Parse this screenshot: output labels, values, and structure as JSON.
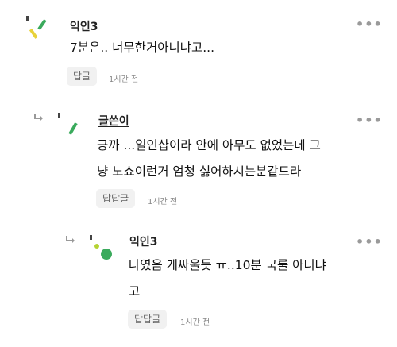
{
  "comments": [
    {
      "author": "익인3",
      "lines": [
        "7분은.. 너무한거아니냐고..."
      ],
      "reply_label": "답글",
      "time": "1시간 전"
    },
    {
      "author": "글쓴이",
      "lines": [
        "긍까 ...일인샵이라 안에 아무도 없었는데 그",
        "냥 노쇼이런거 엄청 싫어하시는분같드라"
      ],
      "reply_label": "답답글",
      "time": "1시간 전"
    },
    {
      "author": "익인3",
      "lines": [
        "나였음 개싸울듯 ㅠ..10분 국룰 아니냐",
        "고"
      ],
      "reply_label": "답답글",
      "time": "1시간 전"
    }
  ],
  "more_glyph": "•••",
  "colors": {
    "avatar_green": "#3aaa5c",
    "avatar_lime": "#b5d334",
    "avatar_yellow": "#e8d23a",
    "avatar_dark": "#444444"
  }
}
